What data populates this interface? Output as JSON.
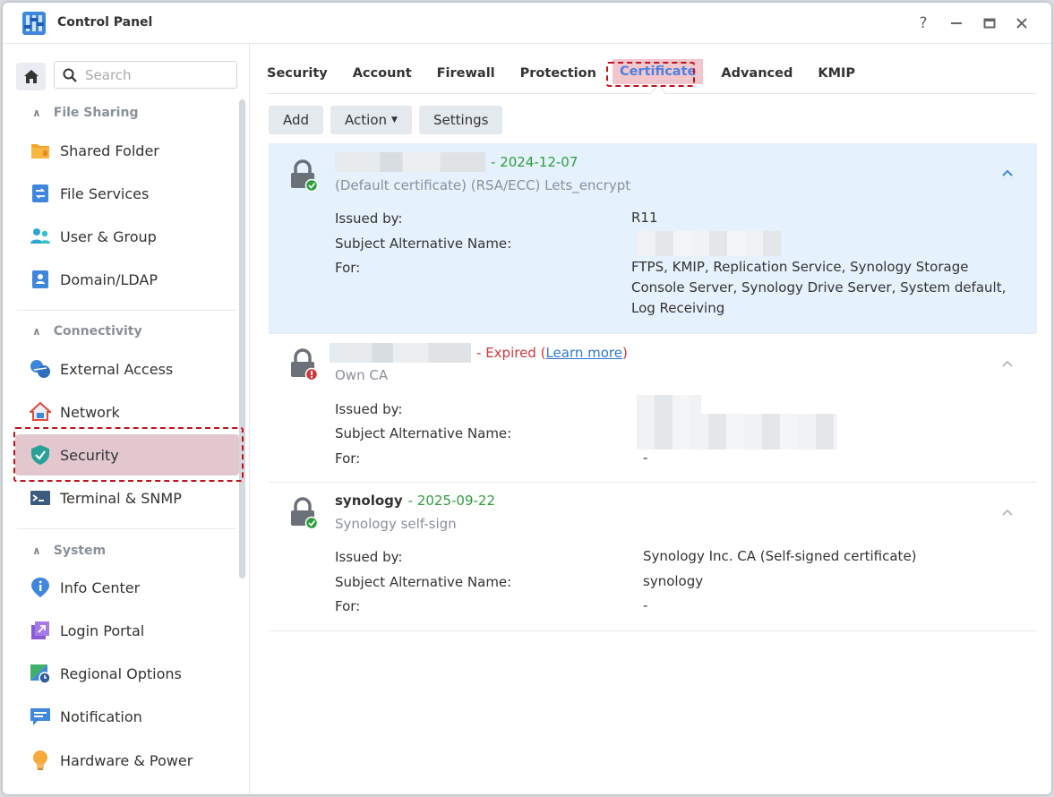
{
  "window": {
    "title": "Control Panel",
    "help_label": "?",
    "minimize_label": "—",
    "maximize_label": "▭",
    "close_label": "✕"
  },
  "sidebar": {
    "search_placeholder": "Search",
    "groups": [
      {
        "label": "File Sharing",
        "items": [
          "Shared Folder",
          "File Services",
          "User & Group",
          "Domain/LDAP"
        ]
      },
      {
        "label": "Connectivity",
        "items": [
          "External Access",
          "Network",
          "Security",
          "Terminal & SNMP"
        ]
      },
      {
        "label": "System",
        "items": [
          "Info Center",
          "Login Portal",
          "Regional Options",
          "Notification",
          "Hardware & Power"
        ]
      }
    ],
    "active_item": "Security"
  },
  "tabs": [
    "Security",
    "Account",
    "Firewall",
    "Protection",
    "Certificate",
    "Advanced",
    "KMIP"
  ],
  "active_tab": "Certificate",
  "toolbar": {
    "add_label": "Add",
    "action_label": "Action",
    "settings_label": "Settings"
  },
  "certificates": [
    {
      "name": "",
      "separator": "- ",
      "status": "2024-12-07",
      "subtitle": "(Default certificate) (RSA/ECC) Lets_encrypt",
      "issued_by_label": "Issued by:",
      "issued_by": "R11",
      "san_label": "Subject Alternative Name:",
      "san": "",
      "for_label": "For:",
      "for": "FTPS, KMIP, Replication Service, Synology Storage Console Server, Synology Drive Server, System default, Log Receiving"
    },
    {
      "name": "",
      "separator": "- ",
      "status": "Expired",
      "link_open": " (",
      "link": "Learn more",
      "link_close": ")",
      "subtitle": "Own CA",
      "issued_by_label": "Issued by:",
      "issued_by": "",
      "san_label": "Subject Alternative Name:",
      "san": "",
      "for_label": "For:",
      "for": "-"
    },
    {
      "name": "synology",
      "separator": "- ",
      "status": "2025-09-22",
      "subtitle": "Synology self-sign",
      "issued_by_label": "Issued by:",
      "issued_by": "Synology Inc. CA (Self-signed certificate)",
      "san_label": "Subject Alternative Name:",
      "san": "synology",
      "for_label": "For:",
      "for": "-"
    }
  ],
  "colors": {
    "accent": "#4f7fe0",
    "valid_green": "#2e9e3c",
    "expired_red": "#d4343b",
    "highlight_red": "#c0121c",
    "selected_row": "#e5f1fc"
  }
}
